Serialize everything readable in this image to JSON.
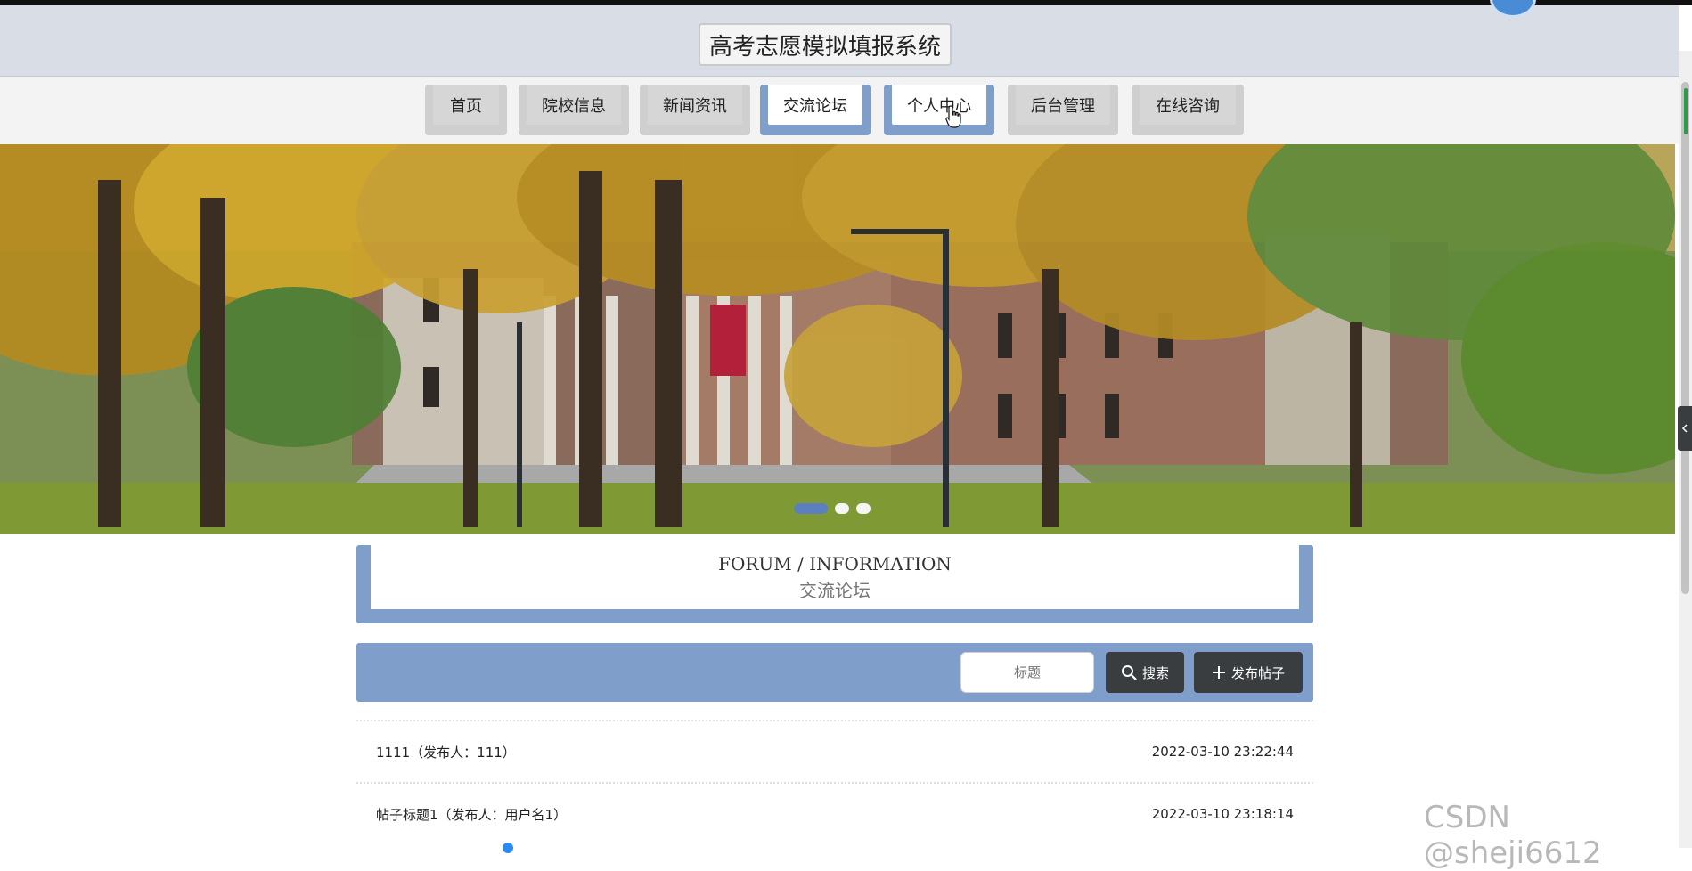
{
  "header": {
    "title": "高考志愿模拟填报系统"
  },
  "nav": {
    "items": [
      {
        "label": "首页",
        "active": false
      },
      {
        "label": "院校信息",
        "active": false
      },
      {
        "label": "新闻资讯",
        "active": false
      },
      {
        "label": "交流论坛",
        "active": true
      },
      {
        "label": "个人中心",
        "active": true
      },
      {
        "label": "后台管理",
        "active": false
      },
      {
        "label": "在线咨询",
        "active": false
      }
    ]
  },
  "banner": {
    "slides": 3,
    "active_slide": 1
  },
  "section": {
    "title_en": "FORUM / INFORMATION",
    "title_cn": "交流论坛"
  },
  "search": {
    "placeholder": "标题",
    "search_label": "搜索",
    "post_label": "发布帖子"
  },
  "posts": [
    {
      "title": "1111（发布人：111）",
      "time": "2022-03-10 23:22:44"
    },
    {
      "title": "帖子标题1（发布人：用户名1）",
      "time": "2022-03-10 23:18:14"
    }
  ],
  "watermark": "CSDN @sheji6612",
  "colors": {
    "accent": "#7f9ec9",
    "header_bg": "#d9dee6",
    "dark_button": "#3a3d40"
  }
}
